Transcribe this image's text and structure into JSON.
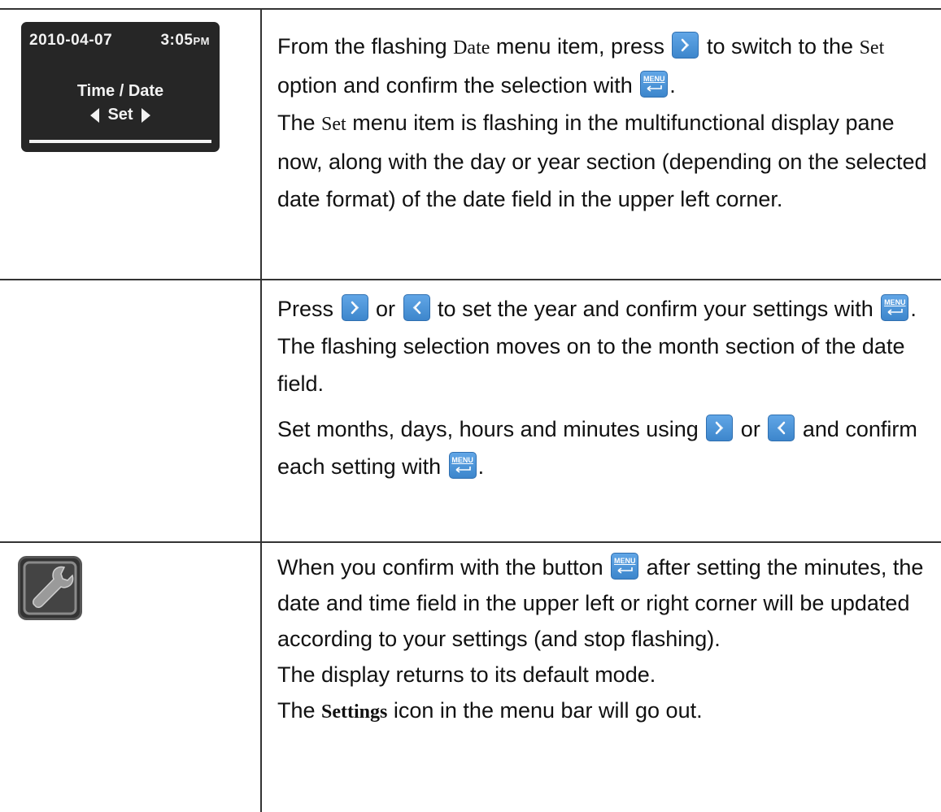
{
  "lcd": {
    "date": "2010-04-07",
    "time": "3:05",
    "ampm": "PM",
    "title": "Time / Date",
    "option": "Set"
  },
  "icons": {
    "right_button": "chevron-right-icon",
    "left_button": "chevron-left-icon",
    "menu_button_label": "MENU",
    "menu_button_icon": "return-arrow-icon",
    "settings": "wrench-icon"
  },
  "colors": {
    "button_blue": "#4a93d8",
    "lcd_background": "#262626",
    "rule": "#333333"
  },
  "step1": {
    "p1_a": "From the flashing ",
    "p1_term1": "Date",
    "p1_b": " menu item, press ",
    "p1_c": " to switch to the ",
    "p1_term2": "Set",
    "p1_d": " option and confirm the selection with ",
    "p1_e": ".",
    "p2_a": "The ",
    "p2_term": "Set",
    "p2_b": " menu item is flashing in the multifunctional display pane now, along with the day or year section (depending on the selected date format) of the date field in the upper left corner."
  },
  "step2": {
    "p1_a": "Press ",
    "p1_b": " or ",
    "p1_c": " to set the year and confirm your settings with ",
    "p1_d": ".",
    "p2": "The flashing selection moves on to the month section of the date field.",
    "p3_a": "Set months, days, hours and minutes using ",
    "p3_b": " or ",
    "p3_c": " and confirm each setting with ",
    "p3_d": "."
  },
  "step3": {
    "p1_a": "When you confirm with the button ",
    "p1_b": " after setting the minutes, the date and time field in the upper left or right corner will be updated according to your settings (and stop flashing).",
    "p2": "The display returns to its default mode.",
    "p3_a": "The ",
    "p3_term": "Settings",
    "p3_b": " icon in the menu bar will go out."
  }
}
